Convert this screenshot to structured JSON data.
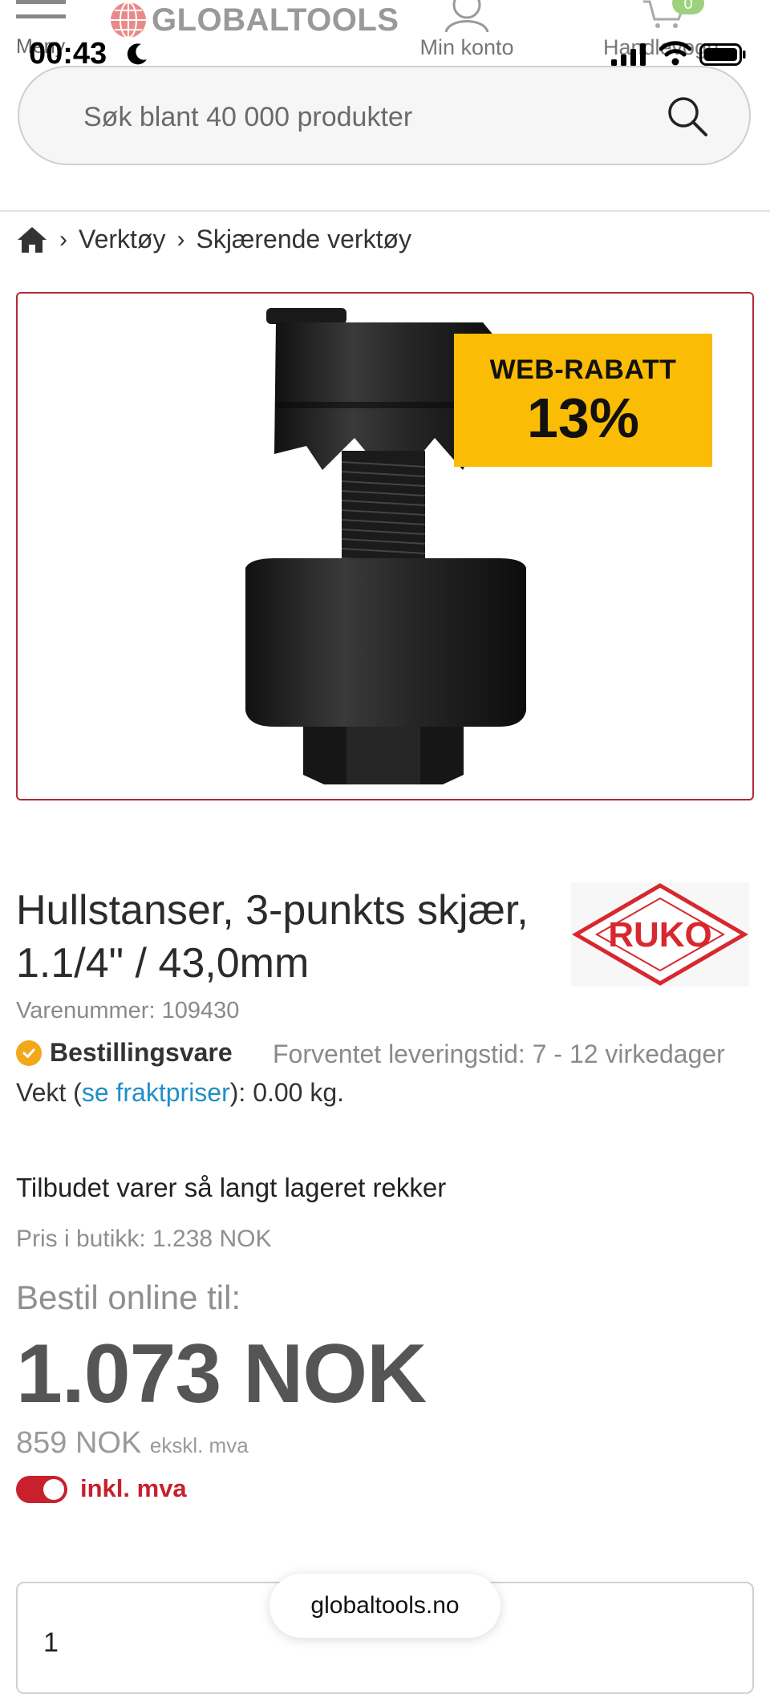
{
  "status_bar": {
    "time": "00:43"
  },
  "header": {
    "menu_label": "Meny",
    "logo_text": "GLOBALTOOLS",
    "account_label": "Min konto",
    "cart_label": "Handlevogn",
    "cart_count": "0"
  },
  "search": {
    "placeholder": "Søk blant 40 000 produkter"
  },
  "breadcrumb": {
    "items": [
      "Verktøy",
      "Skjærende verktøy"
    ]
  },
  "product": {
    "badge_title": "WEB-RABATT",
    "badge_percent": "13%",
    "title": "Hullstanser, 3-punkts skjær, 1.1/4\" / 43,0mm",
    "brand": "RUKO",
    "sku_label": "Varenummer: 109430",
    "stock_label": "Bestillingsvare",
    "delivery_text": "Forventet leveringstid: 7 - 12 virkedager",
    "weight_prefix": "Vekt (",
    "weight_link": "se fraktpriser",
    "weight_suffix": "): 0.00 kg.",
    "offer_text": "Tilbudet varer så langt lageret rekker",
    "store_price": "Pris i butikk: 1.238 NOK",
    "online_label": "Bestil online til:",
    "price": "1.073 NOK",
    "ex_vat_price": "859 NOK",
    "ex_vat_label": "ekskl. mva",
    "vat_toggle_label": "inkl. mva",
    "vat_toggle_on": true,
    "quantity": "1"
  },
  "browser": {
    "url": "globaltools.no"
  },
  "colors": {
    "accent_red": "#c8202d",
    "badge_yellow": "#fbbc05",
    "link_blue": "#1f8fc7",
    "stock_orange": "#f2a81a"
  }
}
